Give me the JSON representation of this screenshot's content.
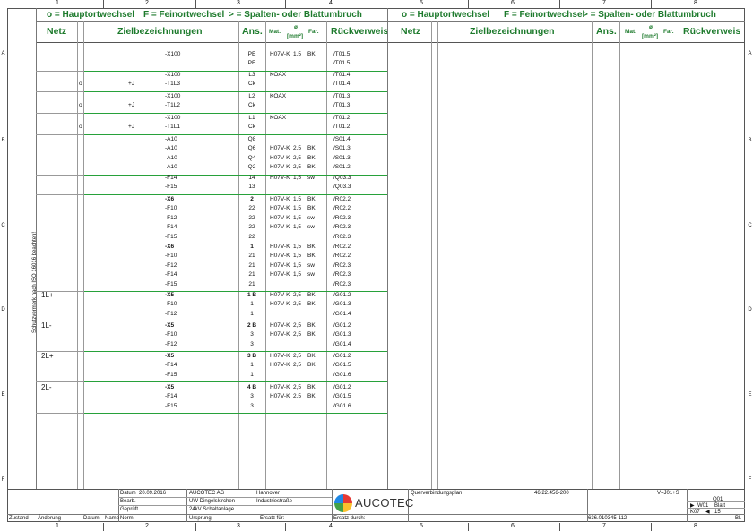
{
  "column_numbers": [
    "1",
    "2",
    "3",
    "4",
    "5",
    "6",
    "7",
    "8"
  ],
  "row_letters": [
    "A",
    "B",
    "C",
    "D",
    "E",
    "F"
  ],
  "header": {
    "legend_o": "o = Hauptortwechsel",
    "legend_f": "F = Feinortwechsel",
    "legend_gt": "> = Spalten- oder Blattumbruch"
  },
  "columns": {
    "netz": "Netz",
    "ziel": "Zielbezeichnungen",
    "ans": "Ans.",
    "mat": "Mat.",
    "diam": "ø",
    "mm2": "[mm²]",
    "far": "Far.",
    "rueck": "Rückverweis"
  },
  "vertical_note": "Schutzvermerk nach ISO 16016 beachten!",
  "blocks": [
    {
      "netz": "",
      "rows": [
        {
          "o": "",
          "pre": "",
          "ziel": "-X100",
          "b": false,
          "ans": "PE",
          "mat": "H07V-K",
          "mm": "1,5",
          "far": "BK",
          "ref": "/T01.5"
        },
        {
          "o": "",
          "pre": "",
          "ziel": "",
          "b": false,
          "ans": "PE",
          "mat": "",
          "mm": "",
          "far": "",
          "ref": "/T01.5"
        }
      ]
    },
    {
      "netz": "",
      "rows": [
        {
          "o": "",
          "pre": "",
          "ziel": "-X100",
          "b": false,
          "ans": "L3",
          "mat": "KOAX",
          "mm": "",
          "far": "",
          "ref": "/T01.4"
        },
        {
          "o": "o",
          "pre": "+J",
          "ziel": "-T1L3",
          "b": false,
          "ans": "Ck",
          "mat": "",
          "mm": "",
          "far": "",
          "ref": "/T01.4"
        }
      ]
    },
    {
      "netz": "",
      "rows": [
        {
          "o": "",
          "pre": "",
          "ziel": "-X100",
          "b": false,
          "ans": "L2",
          "mat": "KOAX",
          "mm": "",
          "far": "",
          "ref": "/T01.3"
        },
        {
          "o": "o",
          "pre": "+J",
          "ziel": "-T1L2",
          "b": false,
          "ans": "Ck",
          "mat": "",
          "mm": "",
          "far": "",
          "ref": "/T01.3"
        }
      ]
    },
    {
      "netz": "",
      "rows": [
        {
          "o": "",
          "pre": "",
          "ziel": "-X100",
          "b": false,
          "ans": "L1",
          "mat": "KOAX",
          "mm": "",
          "far": "",
          "ref": "/T01.2"
        },
        {
          "o": "o",
          "pre": "+J",
          "ziel": "-T1L1",
          "b": false,
          "ans": "Ck",
          "mat": "",
          "mm": "",
          "far": "",
          "ref": "/T01.2"
        }
      ]
    },
    {
      "netz": "",
      "rows": [
        {
          "o": "",
          "pre": "",
          "ziel": "-A10",
          "b": false,
          "ans": "Q8",
          "mat": "",
          "mm": "",
          "far": "",
          "ref": "/S01.4"
        },
        {
          "o": "",
          "pre": "",
          "ziel": "-A10",
          "b": false,
          "ans": "Q6",
          "mat": "H07V-K",
          "mm": "2,5",
          "far": "BK",
          "ref": "/S01.3"
        },
        {
          "o": "",
          "pre": "",
          "ziel": "-A10",
          "b": false,
          "ans": "Q4",
          "mat": "H07V-K",
          "mm": "2,5",
          "far": "BK",
          "ref": "/S01.3"
        },
        {
          "o": "",
          "pre": "",
          "ziel": "-A10",
          "b": false,
          "ans": "Q2",
          "mat": "H07V-K",
          "mm": "2,5",
          "far": "BK",
          "ref": "/S01.2"
        }
      ]
    },
    {
      "netz": "",
      "rows": [
        {
          "o": "",
          "pre": "",
          "ziel": "-F14",
          "b": false,
          "ans": "14",
          "mat": "H07V-K",
          "mm": "1,5",
          "far": "sw",
          "ref": "/Q03.3"
        },
        {
          "o": "",
          "pre": "",
          "ziel": "-F15",
          "b": false,
          "ans": "13",
          "mat": "",
          "mm": "",
          "far": "",
          "ref": "/Q03.3"
        }
      ]
    },
    {
      "netz": "",
      "rows": [
        {
          "o": "",
          "pre": "",
          "ziel": "-X6",
          "b": true,
          "ans": "2",
          "mat": "H07V-K",
          "mm": "1,5",
          "far": "BK",
          "ref": "/R02.2"
        },
        {
          "o": "",
          "pre": "",
          "ziel": "-F10",
          "b": false,
          "ans": "22",
          "mat": "H07V-K",
          "mm": "1,5",
          "far": "BK",
          "ref": "/R02.2"
        },
        {
          "o": "",
          "pre": "",
          "ziel": "-F12",
          "b": false,
          "ans": "22",
          "mat": "H07V-K",
          "mm": "1,5",
          "far": "sw",
          "ref": "/R02.3"
        },
        {
          "o": "",
          "pre": "",
          "ziel": "-F14",
          "b": false,
          "ans": "22",
          "mat": "H07V-K",
          "mm": "1,5",
          "far": "sw",
          "ref": "/R02.3"
        },
        {
          "o": "",
          "pre": "",
          "ziel": "-F15",
          "b": false,
          "ans": "22",
          "mat": "",
          "mm": "",
          "far": "",
          "ref": "/R02.3"
        }
      ]
    },
    {
      "netz": "",
      "rows": [
        {
          "o": "",
          "pre": "",
          "ziel": "-X6",
          "b": true,
          "ans": "1",
          "mat": "H07V-K",
          "mm": "1,5",
          "far": "BK",
          "ref": "/R02.2"
        },
        {
          "o": "",
          "pre": "",
          "ziel": "-F10",
          "b": false,
          "ans": "21",
          "mat": "H07V-K",
          "mm": "1,5",
          "far": "BK",
          "ref": "/R02.2"
        },
        {
          "o": "",
          "pre": "",
          "ziel": "-F12",
          "b": false,
          "ans": "21",
          "mat": "H07V-K",
          "mm": "1,5",
          "far": "sw",
          "ref": "/R02.3"
        },
        {
          "o": "",
          "pre": "",
          "ziel": "-F14",
          "b": false,
          "ans": "21",
          "mat": "H07V-K",
          "mm": "1,5",
          "far": "sw",
          "ref": "/R02.3"
        },
        {
          "o": "",
          "pre": "",
          "ziel": "-F15",
          "b": false,
          "ans": "21",
          "mat": "",
          "mm": "",
          "far": "",
          "ref": "/R02.3"
        }
      ]
    },
    {
      "netz": "1L+",
      "rows": [
        {
          "o": "",
          "pre": "",
          "ziel": "-X5",
          "b": true,
          "ans": "1 B",
          "mat": "H07V-K",
          "mm": "2,5",
          "far": "BK",
          "ref": "/G01.2"
        },
        {
          "o": "",
          "pre": "",
          "ziel": "-F10",
          "b": false,
          "ans": "1",
          "mat": "H07V-K",
          "mm": "2,5",
          "far": "BK",
          "ref": "/G01.3"
        },
        {
          "o": "",
          "pre": "",
          "ziel": "-F12",
          "b": false,
          "ans": "1",
          "mat": "",
          "mm": "",
          "far": "",
          "ref": "/G01.4"
        }
      ]
    },
    {
      "netz": "1L-",
      "rows": [
        {
          "o": "",
          "pre": "",
          "ziel": "-X5",
          "b": true,
          "ans": "2 B",
          "mat": "H07V-K",
          "mm": "2,5",
          "far": "BK",
          "ref": "/G01.2"
        },
        {
          "o": "",
          "pre": "",
          "ziel": "-F10",
          "b": false,
          "ans": "3",
          "mat": "H07V-K",
          "mm": "2,5",
          "far": "BK",
          "ref": "/G01.3"
        },
        {
          "o": "",
          "pre": "",
          "ziel": "-F12",
          "b": false,
          "ans": "3",
          "mat": "",
          "mm": "",
          "far": "",
          "ref": "/G01.4"
        }
      ]
    },
    {
      "netz": "2L+",
      "rows": [
        {
          "o": "",
          "pre": "",
          "ziel": "-X5",
          "b": true,
          "ans": "3 B",
          "mat": "H07V-K",
          "mm": "2,5",
          "far": "BK",
          "ref": "/G01.2"
        },
        {
          "o": "",
          "pre": "",
          "ziel": "-F14",
          "b": false,
          "ans": "1",
          "mat": "H07V-K",
          "mm": "2,5",
          "far": "BK",
          "ref": "/G01.5"
        },
        {
          "o": "",
          "pre": "",
          "ziel": "-F15",
          "b": false,
          "ans": "1",
          "mat": "",
          "mm": "",
          "far": "",
          "ref": "/G01.6"
        }
      ]
    },
    {
      "netz": "2L-",
      "rows": [
        {
          "o": "",
          "pre": "",
          "ziel": "-X5",
          "b": true,
          "ans": "4 B",
          "mat": "H07V-K",
          "mm": "2,5",
          "far": "BK",
          "ref": "/G01.2"
        },
        {
          "o": "",
          "pre": "",
          "ziel": "-F14",
          "b": false,
          "ans": "3",
          "mat": "H07V-K",
          "mm": "2,5",
          "far": "BK",
          "ref": "/G01.5"
        },
        {
          "o": "",
          "pre": "",
          "ziel": "-F15",
          "b": false,
          "ans": "3",
          "mat": "",
          "mm": "",
          "far": "",
          "ref": "/G01.6"
        }
      ]
    }
  ],
  "titleblock": {
    "datum_label": "Datum",
    "datum": "20.09.2016",
    "bearb_label": "Bearb.",
    "gepr_label": "Geprüft",
    "company": "AUCOTEC AG",
    "city": "Hannover",
    "project1": "UW Dingelskirchen",
    "street": "Industriestraße",
    "project2": "24kV Schaltanlage",
    "zustand": "Zustand",
    "aenderung": "Änderung",
    "datum2": "Datum",
    "name": "Name",
    "norm": "Norm",
    "ursprung": "Ursprung:",
    "ersatz_fuer": "Ersatz für:",
    "ersatz_durch": "Ersatz durch:",
    "logo": "AUCOTEC",
    "doc_title": "Querverbindungsplan",
    "doc_no": "46.22.456-200",
    "location": "V=J01+S",
    "q01": "Q01",
    "w01": "W01",
    "blatt": "Blatt",
    "k07": "K07",
    "page": "15",
    "bl": "Bl.",
    "drawing_no": "636.010345-112"
  }
}
